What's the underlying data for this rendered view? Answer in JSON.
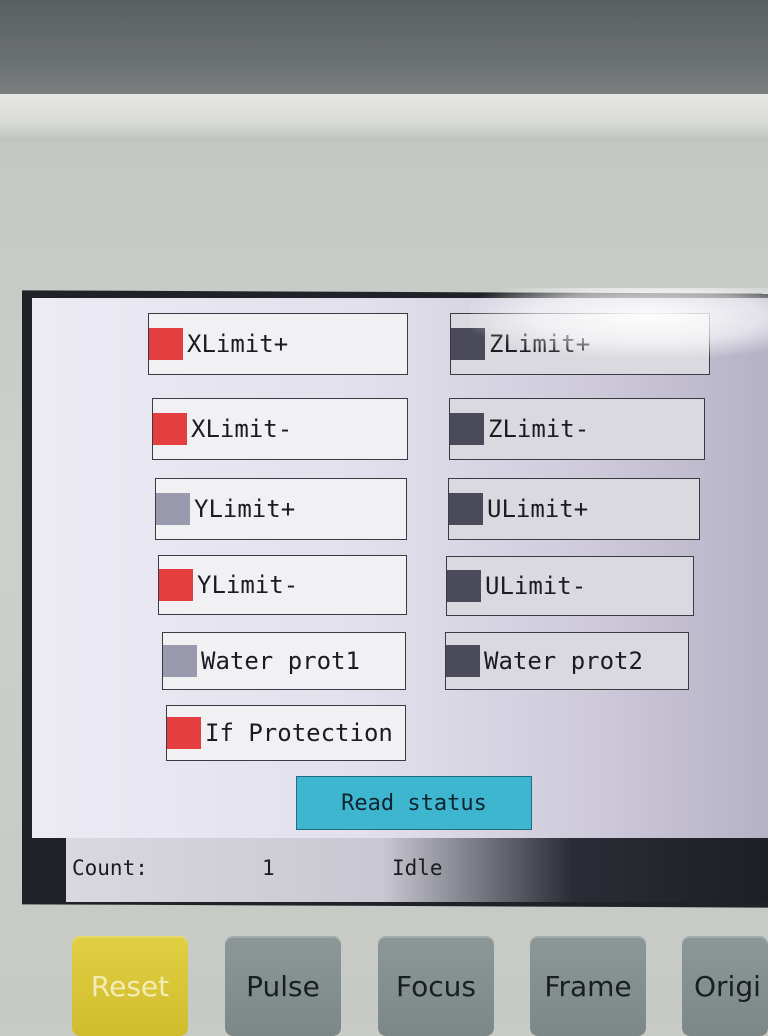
{
  "io_status": {
    "left": [
      {
        "label": "XLimit+",
        "led_color": "#e53e3e"
      },
      {
        "label": "XLimit-",
        "led_color": "#e53e3e"
      },
      {
        "label": "YLimit+",
        "led_color": "#9a9aae"
      },
      {
        "label": "YLimit-",
        "led_color": "#e53e3e"
      },
      {
        "label": "Water prot1",
        "led_color": "#9a9aae"
      },
      {
        "label": "If Protection",
        "led_color": "#e53e3e"
      }
    ],
    "right": [
      {
        "label": "ZLimit+",
        "led_color": "#4a4a5a"
      },
      {
        "label": "ZLimit-",
        "led_color": "#4a4a5a"
      },
      {
        "label": "ULimit+",
        "led_color": "#4a4a5a"
      },
      {
        "label": "ULimit-",
        "led_color": "#4a4a5a"
      },
      {
        "label": "Water prot2",
        "led_color": "#4a4a5a"
      }
    ]
  },
  "read_status_button": "Read status",
  "status_bar": {
    "count_label": "Count:",
    "count_value": "1",
    "state": "Idle"
  },
  "keys": {
    "reset": "Reset",
    "pulse": "Pulse",
    "focus": "Focus",
    "frame": "Frame",
    "origin": "Origi"
  }
}
